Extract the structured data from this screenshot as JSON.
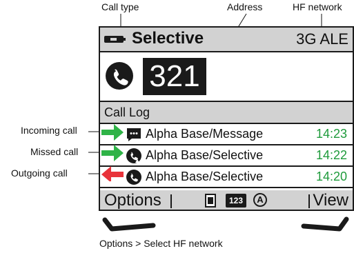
{
  "annotations": {
    "call_type": "Call type",
    "address": "Address",
    "hf_network": "HF network",
    "incoming": "Incoming call",
    "missed": "Missed call",
    "outgoing": "Outgoing call",
    "caption": "Options > Select HF network"
  },
  "header": {
    "title": "Selective",
    "network": "3G ALE"
  },
  "address": "321",
  "call_log": {
    "heading": "Call Log",
    "rows": [
      {
        "name": "Alpha Base/Message",
        "time": "14:23",
        "icon": "message-icon"
      },
      {
        "name": "Alpha Base/Selective",
        "time": "14:22",
        "icon": "missed-call-icon"
      },
      {
        "name": "Alpha Base/Selective",
        "time": "14:20",
        "icon": "phone-icon"
      }
    ]
  },
  "footer": {
    "left": "Options",
    "right": "View",
    "keypad": "123",
    "mode": "A"
  },
  "colors": {
    "time": "#1d9a3a",
    "incoming_arrow": "#2fb347",
    "outgoing_arrow": "#e8333a"
  }
}
